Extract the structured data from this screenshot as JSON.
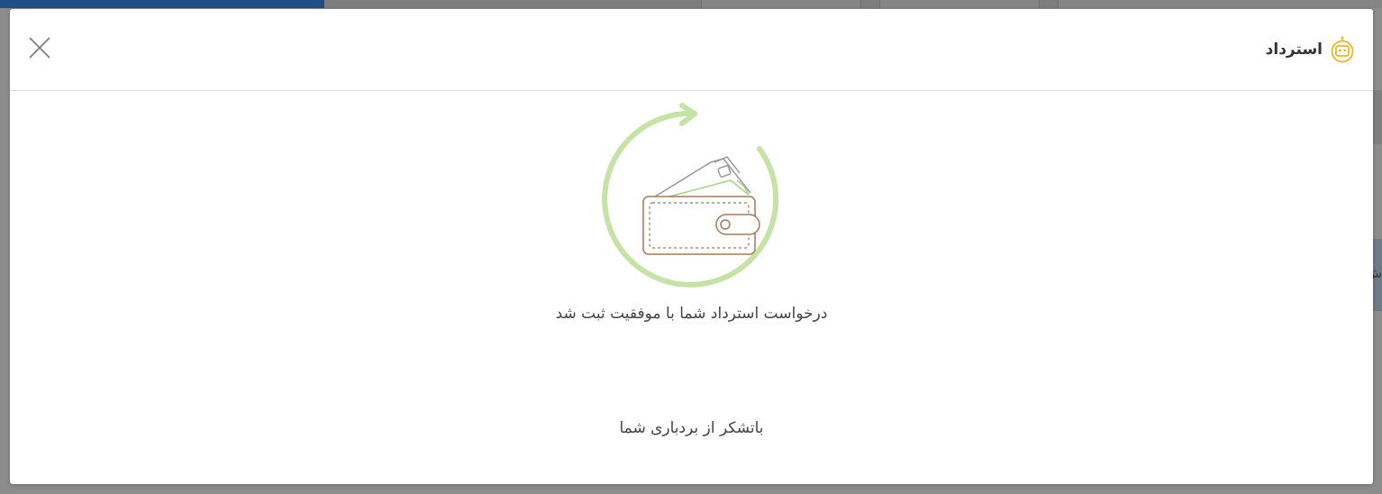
{
  "modal": {
    "title": "استرداد",
    "success_message": "درخواست استرداد شما با موفقیت ثبت شد",
    "thanks_message": "باتشکر از بردباری شما"
  },
  "background": {
    "side_text": "ش"
  },
  "colors": {
    "accent_yellow": "#e8b923",
    "refund_green": "#c7e2a6",
    "wallet_brown": "#a5785a",
    "header_blue": "#1f4f86"
  },
  "icons": {
    "close": "close-icon",
    "title": "refund-robot-icon",
    "illustration": "wallet-refund-icon"
  }
}
